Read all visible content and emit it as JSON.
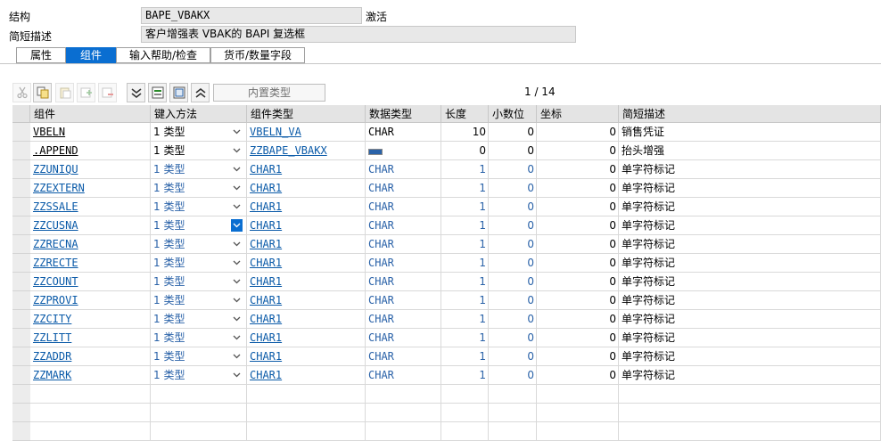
{
  "header": {
    "structure_label": "结构",
    "structure_value": "BAPE_VBAKX",
    "structure_status": "激活",
    "desc_label": "简短描述",
    "desc_value": "客户增强表 VBAK的 BAPI 复选框"
  },
  "tabs": [
    {
      "label": "属性",
      "active": false
    },
    {
      "label": "组件",
      "active": true
    },
    {
      "label": "输入帮助/检查",
      "active": false
    },
    {
      "label": "货币/数量字段",
      "active": false
    }
  ],
  "toolbar": {
    "icons": [
      "cut-icon",
      "copy-icon",
      "paste-icon",
      "insert-row-icon",
      "delete-row-icon",
      "expand-icon",
      "new-row-icon",
      "table-icon",
      "collapse-icon"
    ],
    "builtin_type_label": "内置类型",
    "pager_text": "1 / 14"
  },
  "table": {
    "columns": [
      "组件",
      "键入方法",
      "组件类型",
      "数据类型",
      "长度",
      "小数位",
      "坐标",
      "简短描述"
    ],
    "rows": [
      {
        "component": "VBELN",
        "method": "1 类型",
        "type": "VBELN_VA",
        "dtype": "CHAR",
        "len": "10",
        "dec": "0",
        "coord": "0",
        "desc": "销售凭证",
        "style": "normal"
      },
      {
        "component": ".APPEND",
        "method": "1 类型",
        "type": "ZZBAPE_VBAKX",
        "dtype": "",
        "len": "0",
        "dec": "0",
        "coord": "0",
        "desc": "抬头增强",
        "style": "normal"
      },
      {
        "component": "ZZUNIQU",
        "method": "1 类型",
        "type": "CHAR1",
        "dtype": "CHAR",
        "len": "1",
        "dec": "0",
        "coord": "0",
        "desc": "单字符标记",
        "style": "blue"
      },
      {
        "component": "ZZEXTERN",
        "method": "1 类型",
        "type": "CHAR1",
        "dtype": "CHAR",
        "len": "1",
        "dec": "0",
        "coord": "0",
        "desc": "单字符标记",
        "style": "blue"
      },
      {
        "component": "ZZSSALE",
        "method": "1 类型",
        "type": "CHAR1",
        "dtype": "CHAR",
        "len": "1",
        "dec": "0",
        "coord": "0",
        "desc": "单字符标记",
        "style": "blue"
      },
      {
        "component": "ZZCUSNA",
        "method": "1 类型",
        "type": "CHAR1",
        "dtype": "CHAR",
        "len": "1",
        "dec": "0",
        "coord": "0",
        "desc": "单字符标记",
        "style": "blue"
      },
      {
        "component": "ZZRECNA",
        "method": "1 类型",
        "type": "CHAR1",
        "dtype": "CHAR",
        "len": "1",
        "dec": "0",
        "coord": "0",
        "desc": "单字符标记",
        "style": "blue"
      },
      {
        "component": "ZZRECTE",
        "method": "1 类型",
        "type": "CHAR1",
        "dtype": "CHAR",
        "len": "1",
        "dec": "0",
        "coord": "0",
        "desc": "单字符标记",
        "style": "blue"
      },
      {
        "component": "ZZCOUNT",
        "method": "1 类型",
        "type": "CHAR1",
        "dtype": "CHAR",
        "len": "1",
        "dec": "0",
        "coord": "0",
        "desc": "单字符标记",
        "style": "blue"
      },
      {
        "component": "ZZPROVI",
        "method": "1 类型",
        "type": "CHAR1",
        "dtype": "CHAR",
        "len": "1",
        "dec": "0",
        "coord": "0",
        "desc": "单字符标记",
        "style": "blue"
      },
      {
        "component": "ZZCITY",
        "method": "1 类型",
        "type": "CHAR1",
        "dtype": "CHAR",
        "len": "1",
        "dec": "0",
        "coord": "0",
        "desc": "单字符标记",
        "style": "blue"
      },
      {
        "component": "ZZLITT",
        "method": "1 类型",
        "type": "CHAR1",
        "dtype": "CHAR",
        "len": "1",
        "dec": "0",
        "coord": "0",
        "desc": "单字符标记",
        "style": "blue"
      },
      {
        "component": "ZZADDR",
        "method": "1 类型",
        "type": "CHAR1",
        "dtype": "CHAR",
        "len": "1",
        "dec": "0",
        "coord": "0",
        "desc": "单字符标记",
        "style": "blue"
      },
      {
        "component": "ZZMARK",
        "method": "1 类型",
        "type": "CHAR1",
        "dtype": "CHAR",
        "len": "1",
        "dec": "0",
        "coord": "0",
        "desc": "单字符标记",
        "style": "blue"
      }
    ],
    "empty_rows": 3
  },
  "colors": {
    "accent": "#0a6ed1",
    "link": "#0a5aa8",
    "header_bg": "#e4e4e4"
  }
}
